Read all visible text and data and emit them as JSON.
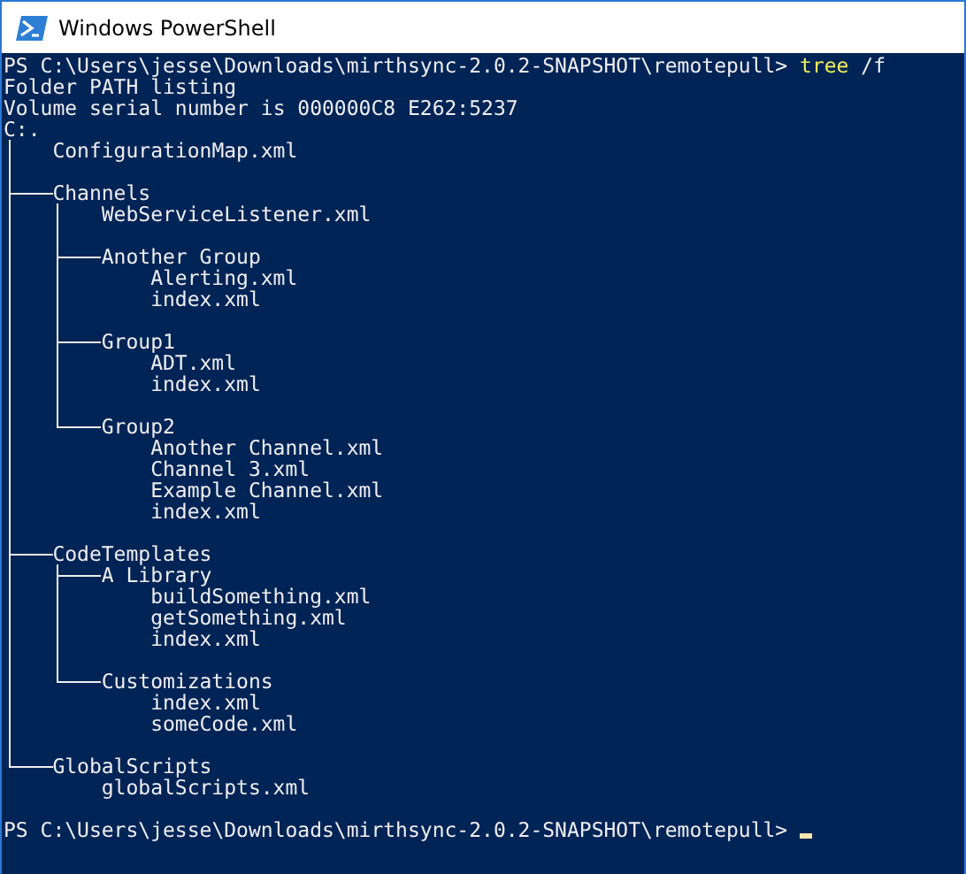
{
  "window": {
    "title": "Windows PowerShell"
  },
  "console": {
    "command_line": {
      "prompt": "PS C:\\Users\\jesse\\Downloads\\mirthsync-2.0.2-SNAPSHOT\\remotepull>",
      "command": "tree",
      "args": "/f"
    },
    "output": [
      "Folder PATH listing",
      "Volume serial number is 000000C8 E262:5237"
    ],
    "tree": {
      "name": "C:.",
      "files": [
        "ConfigurationMap.xml"
      ],
      "children": [
        {
          "name": "Channels",
          "files": [
            "WebServiceListener.xml"
          ],
          "children": [
            {
              "name": "Another Group",
              "files": [
                "Alerting.xml",
                "index.xml"
              ]
            },
            {
              "name": "Group1",
              "files": [
                "ADT.xml",
                "index.xml"
              ]
            },
            {
              "name": "Group2",
              "files": [
                "Another Channel.xml",
                "Channel 3.xml",
                "Example Channel.xml",
                "index.xml"
              ]
            }
          ]
        },
        {
          "name": "CodeTemplates",
          "children": [
            {
              "name": "A Library",
              "files": [
                "buildSomething.xml",
                "getSomething.xml",
                "index.xml"
              ]
            },
            {
              "name": "Customizations",
              "files": [
                "index.xml",
                "someCode.xml"
              ]
            }
          ]
        },
        {
          "name": "GlobalScripts",
          "files": [
            "globalScripts.xml"
          ]
        }
      ]
    },
    "final_prompt": "PS C:\\Users\\jesse\\Downloads\\mirthsync-2.0.2-SNAPSHOT\\remotepull>"
  }
}
